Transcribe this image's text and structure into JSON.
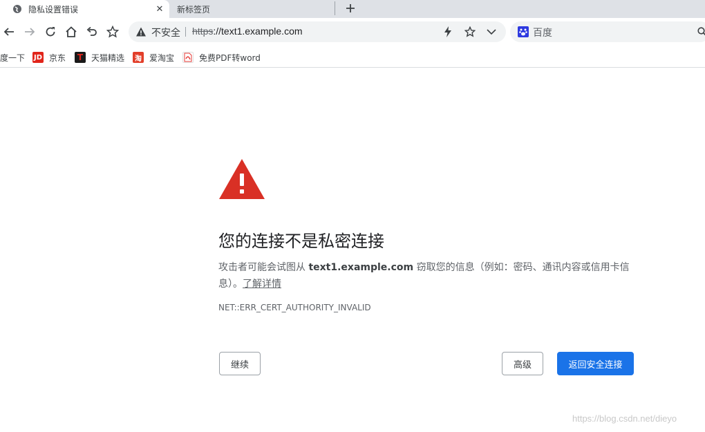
{
  "tabs": [
    {
      "label": "隐私设置错误",
      "active": true
    },
    {
      "label": "新标签页",
      "active": false
    }
  ],
  "toolbar": {
    "security_label": "不安全",
    "url_scheme": "https",
    "url_rest": "://text1.example.com",
    "search_placeholder": "百度"
  },
  "bookmarks": [
    {
      "label": "度一下",
      "icon": "none"
    },
    {
      "label": "京东",
      "icon": "JD",
      "color": "#e1251b"
    },
    {
      "label": "天猫精选",
      "icon": "T",
      "color": "#e2231a"
    },
    {
      "label": "爱淘宝",
      "icon": "淘",
      "color": "#ff4400"
    },
    {
      "label": "免费PDF转word",
      "icon": "pdf-icon",
      "color": "#e53935"
    }
  ],
  "interstitial": {
    "heading": "您的连接不是私密连接",
    "desc_before": "攻击者可能会试图从 ",
    "host": "text1.example.com",
    "desc_after": " 窃取您的信息（例如：密码、通讯内容或信用卡信息）。",
    "learn_more": "了解详情",
    "error_code": "NET::ERR_CERT_AUTHORITY_INVALID",
    "continue_label": "继续",
    "advanced_label": "高级",
    "back_label": "返回安全连接"
  },
  "watermark": "https://blog.csdn.net/dieyo",
  "colors": {
    "accent": "#1a73e8",
    "warning": "#d93025"
  }
}
